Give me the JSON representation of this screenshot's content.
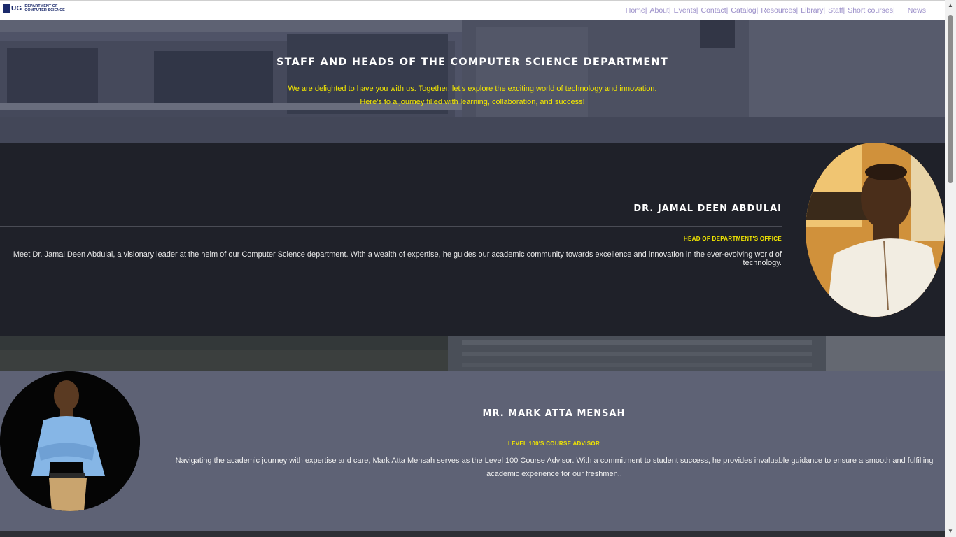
{
  "header": {
    "logo_abbr": "UG",
    "logo_line1": "DEPARTMENT OF",
    "logo_line2": "COMPUTER SCIENCE",
    "nav": [
      "Home|",
      "About|",
      "Events|",
      "Contact|",
      "Catalog|",
      "Resources|",
      "Library|",
      "Staff|",
      "Short courses|",
      "News"
    ]
  },
  "hero": {
    "title": "STAFF AND HEADS OF THE COMPUTER SCIENCE DEPARTMENT",
    "subtitle_line1": "We are delighted to have you with us. Together, let's explore the exciting world of technology and innovation.",
    "subtitle_line2": "Here's to a journey filled with learning, collaboration, and success!"
  },
  "staff": [
    {
      "name": "DR. JAMAL DEEN ABDULAI",
      "role": "HEAD OF DEPARTMENT'S OFFICE",
      "description": "Meet Dr. Jamal Deen Abdulai, a visionary leader at the helm of our Computer Science department. With a wealth of expertise, he guides our academic community towards excellence and innovation in the ever-evolving world of technology."
    },
    {
      "name": "MR. MARK ATTA MENSAH",
      "role": "LEVEL 100'S COURSE ADVISOR",
      "description": "Navigating the academic journey with expertise and care, Mark Atta Mensah serves as the Level 100 Course Advisor. With a commitment to student success, he provides invaluable guidance to ensure a smooth and fulfilling academic experience for our freshmen.."
    }
  ],
  "colors": {
    "accent_yellow": "#f2e600",
    "nav_link": "#9b8fc9",
    "section_dark": "#1f2129",
    "section_slate": "#5e6275"
  }
}
